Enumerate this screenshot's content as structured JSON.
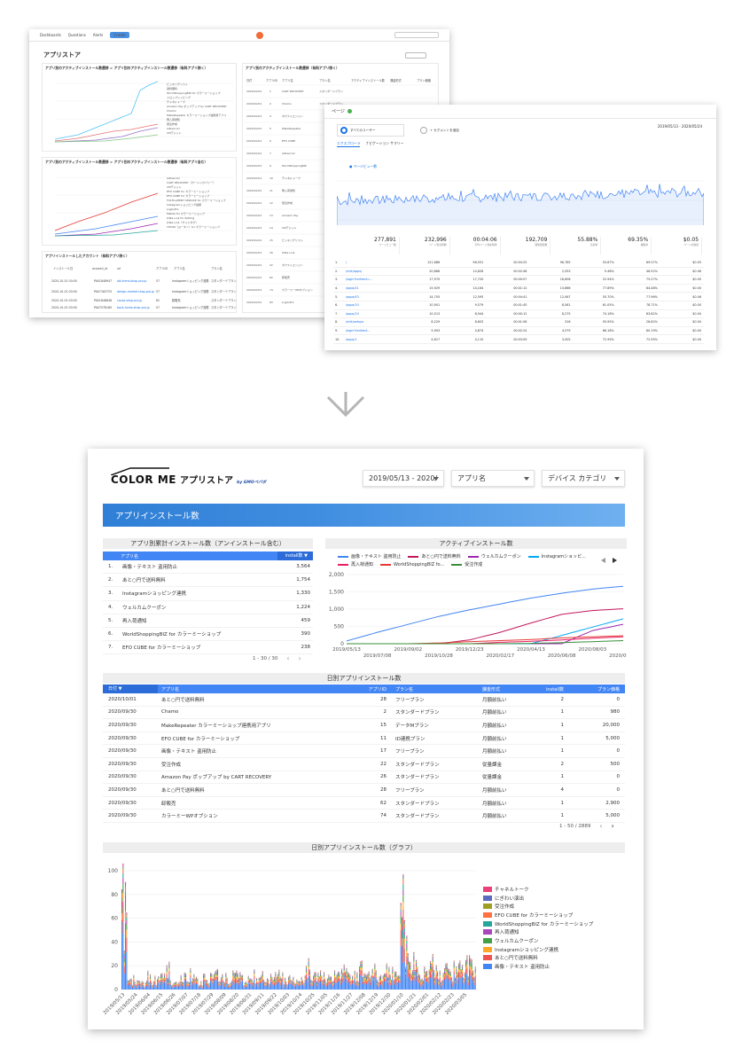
{
  "metabase": {
    "nav": [
      "Dashboards",
      "Questions",
      "Alerts",
      "Create"
    ],
    "title": "アプリストア",
    "panels": [
      {
        "title": "アプリ別のアクティブインストール数遷移 > アプリ別のアクティブインストール数遷移（有料アプリ除く）"
      },
      {
        "title": "アプリ別のアクティブインストール数遷移（有料アプリ除く）"
      },
      {
        "title": "アプリ別のアクティブインストール数遷移 > アプリ別のアクティブインストール数遷移（有料アプリ含む）"
      },
      {
        "title": "アプリインストールしたアカウント（有料アプリ除く）"
      }
    ],
    "table_headers": [
      "日付",
      "アプリID",
      "アプリ名",
      "プラン名",
      "アクティブインストール数",
      "課金形式",
      "プラン価格"
    ]
  },
  "ga": {
    "title": "ページ",
    "segment_all": "すべてのユーザー",
    "segment_add": "+ セグメントを追加",
    "date_range": "2019/05/13 - 2020/05/24",
    "tabs": [
      "エクスプローラ",
      "ナビゲーション サマリー"
    ],
    "metric_label": "● ページビュー数",
    "summary": [
      {
        "num": "277,891",
        "label": "ページビュー数"
      },
      {
        "num": "232,996",
        "label": "ページ別訪問数"
      },
      {
        "num": "00:04:06",
        "label": "平均ページ滞在時間"
      },
      {
        "num": "192,709",
        "label": "閲覧開始数"
      },
      {
        "num": "55.88%",
        "label": "直帰率"
      },
      {
        "num": "69.35%",
        "label": "離脱率"
      },
      {
        "num": "$0.05",
        "label": "ページの価値"
      }
    ],
    "rows": [
      {
        "i": "1.",
        "page": "/",
        "pv": "121,686",
        "u": "96,931",
        "t": "00:04:25",
        "e": "96,785",
        "b": "53.67%",
        "x": "69.57%",
        "v": "$0.05"
      },
      {
        "i": "2.",
        "page": "/mkt/apps/",
        "pv": "20,866",
        "u": "14,826",
        "t": "00:02:48",
        "e": "2,933",
        "b": "9.48%",
        "x": "46.52%",
        "v": "$0.06"
      },
      {
        "i": "3.",
        "page": "/login?redirect=...",
        "pv": "17,970",
        "u": "17,720",
        "t": "00:00:07",
        "e": "16,606",
        "b": "22.94%",
        "x": "75.27%",
        "v": "$0.00"
      },
      {
        "i": "4.",
        "page": "/apps/21",
        "pv": "15,929",
        "u": "14,164",
        "t": "00:01:12",
        "e": "13,666",
        "b": "77.89%",
        "x": "84.48%",
        "v": "$0.00"
      },
      {
        "i": "5.",
        "page": "/apps/43",
        "pv": "14,705",
        "u": "12,595",
        "t": "00:04:41",
        "e": "12,067",
        "b": "55.70%",
        "x": "77.96%",
        "v": "$0.06"
      },
      {
        "i": "6.",
        "page": "/apps/10",
        "pv": "10,901",
        "u": "9,579",
        "t": "00:01:45",
        "e": "8,561",
        "b": "61.05%",
        "x": "78.71%",
        "v": "$0.00"
      },
      {
        "i": "7.",
        "page": "/apps/10",
        "pv": "10,513",
        "u": "8,944",
        "t": "00:00:12",
        "e": "8,275",
        "b": "74.18%",
        "x": "83.82%",
        "v": "$0.00"
      },
      {
        "i": "8.",
        "page": "/mkt/setups",
        "pv": "8,229",
        "u": "8,603",
        "t": "00:01:56",
        "e": "316",
        "b": "93.95%",
        "x": "26.62%",
        "v": "$0.00"
      },
      {
        "i": "9.",
        "page": "/login?redirect...",
        "pv": "5,903",
        "u": "4,874",
        "t": "00:02:24",
        "e": "4,579",
        "b": "66.18%",
        "x": "60.19%",
        "v": "$0.00"
      },
      {
        "i": "10.",
        "page": "/apps/1",
        "pv": "4,617",
        "u": "4,110",
        "t": "00:03:09",
        "e": "3,505",
        "b": "72.99%",
        "x": "72.95%",
        "v": "$0.00"
      }
    ]
  },
  "report": {
    "brand": "COLOR ME",
    "brand_sub": "アプリストア",
    "brand_by": "by GMOペパボ",
    "filters": {
      "date": "2019/05/13 - 2020/",
      "app": "アプリ名",
      "category": "デバイス カテゴリ"
    },
    "banner": "アプリインストール数",
    "cumulative": {
      "title": "アプリ別累計インストール数（アンインストール含む）",
      "col_name": "アプリ名",
      "col_value": "install数 ▼",
      "rows": [
        {
          "i": "1.",
          "name": "画像・テキスト 盗用防止",
          "value": "3,564"
        },
        {
          "i": "2.",
          "name": "あと○円で送料無料",
          "value": "1,754"
        },
        {
          "i": "3.",
          "name": "Instagramショッピング連携",
          "value": "1,330"
        },
        {
          "i": "4.",
          "name": "ウェルカムクーポン",
          "value": "1,224"
        },
        {
          "i": "5.",
          "name": "再入荷通知",
          "value": "459"
        },
        {
          "i": "6.",
          "name": "WorldShoppingBIZ for カラーミーショップ",
          "value": "390"
        },
        {
          "i": "7.",
          "name": "EFO CUBE for カラーミーショップ",
          "value": "238"
        }
      ],
      "pager": "1 - 30 / 30"
    },
    "active": {
      "title": "アクティブインストール数"
    },
    "daily": {
      "title": "日別アプリインストール数",
      "headers": [
        "日付 ▼",
        "アプリ名",
        "アプリID",
        "プラン名",
        "課金形式",
        "install数",
        "プラン価格"
      ],
      "rows": [
        [
          "2020/10/01",
          "あと○円で送料無料",
          "28",
          "フリープラン",
          "月額前払い",
          "2",
          "0"
        ],
        [
          "2020/09/30",
          "Chamo",
          "2",
          "スタンダードプラン",
          "月額前払い",
          "1",
          "980"
        ],
        [
          "2020/09/30",
          "MakeRepeater カラーミーショップ連携用アプリ",
          "15",
          "データMプラン",
          "月額前払い",
          "1",
          "20,000"
        ],
        [
          "2020/09/30",
          "EFO CUBE for カラーミーショップ",
          "11",
          "ID連携プラン",
          "月額前払い",
          "1",
          "5,000"
        ],
        [
          "2020/09/30",
          "画像・テキスト 盗用防止",
          "17",
          "フリープラン",
          "月額前払い",
          "1",
          "0"
        ],
        [
          "2020/09/30",
          "受注作成",
          "22",
          "スタンダードプラン",
          "従量課金",
          "2",
          "500"
        ],
        [
          "2020/09/30",
          "Amazon Pay ポップアップ by CART RECOVERY",
          "26",
          "スタンダードプラン",
          "従量課金",
          "1",
          "0"
        ],
        [
          "2020/09/30",
          "あと○円で送料無料",
          "28",
          "フリープラン",
          "月額前払い",
          "4",
          "0"
        ],
        [
          "2020/09/30",
          "卸販売",
          "62",
          "スタンダードプラン",
          "月額前払い",
          "1",
          "2,900"
        ],
        [
          "2020/09/30",
          "カラーミーWPオプション",
          "74",
          "スタンダードプラン",
          "月額前払い",
          "1",
          "5,000"
        ]
      ],
      "pager": "1 - 50 / 2889"
    },
    "daily_chart": {
      "title": "日別アプリインストール数（グラフ）"
    }
  },
  "chart_data": [
    {
      "type": "line",
      "title": "アクティブインストール数",
      "x": [
        "2019/05/13",
        "2019/07/08",
        "2019/09/02",
        "2019/10/28",
        "2019/12/23",
        "2020/02/17",
        "2020/04/13",
        "2020/06/08",
        "2020/08/03",
        "2020/09/30"
      ],
      "x_tick_labels_top": [
        "2019/05/13",
        "2019/09/02",
        "2019/12/23",
        "2020/04/13",
        "2020/08/03"
      ],
      "x_tick_labels_bottom": [
        "2019/07/08",
        "2019/10/28",
        "2020/02/17",
        "2020/06/08",
        "2020/09/30"
      ],
      "ylim": [
        0,
        2000
      ],
      "yticks": [
        "0",
        "500",
        "1,000",
        "1,500",
        "2,000"
      ],
      "series": [
        {
          "name": "画像・テキスト 盗用防止",
          "color": "#4285f4",
          "values": [
            80,
            330,
            560,
            790,
            980,
            1150,
            1320,
            1460,
            1580,
            1660
          ]
        },
        {
          "name": "あと○円で送料無料",
          "color": "#c2185b",
          "values": [
            0,
            0,
            0,
            0,
            110,
            330,
            600,
            850,
            960,
            1010
          ]
        },
        {
          "name": "ウェルカムクーポン",
          "color": "#9c27b0",
          "values": [
            0,
            0,
            0,
            0,
            0,
            0,
            0,
            0,
            380,
            560
          ]
        },
        {
          "name": "Instagramショッピ...",
          "color": "#03a9f4",
          "values": [
            0,
            0,
            0,
            0,
            0,
            0,
            0,
            240,
            480,
            720
          ]
        },
        {
          "name": "再入荷通知",
          "color": "#e91e63",
          "values": [
            0,
            0,
            0,
            0,
            0,
            40,
            70,
            110,
            160,
            200
          ]
        },
        {
          "name": "WorldShoppingBIZ fo...",
          "color": "#e53935",
          "values": [
            0,
            0,
            0,
            20,
            60,
            90,
            120,
            170,
            200,
            230
          ]
        },
        {
          "name": "受注作成",
          "color": "#388e3c",
          "values": [
            0,
            0,
            0,
            0,
            0,
            0,
            10,
            30,
            60,
            90
          ]
        }
      ]
    },
    {
      "type": "bar",
      "title": "日別アプリインストール数（グラフ）",
      "ylim": [
        0,
        100
      ],
      "yticks": [
        "0",
        "20",
        "40",
        "60",
        "80",
        "100"
      ],
      "x_tick_labels": [
        "2019/05/13",
        "2019/05/24",
        "2019/06/04",
        "2019/06/15",
        "2019/06/26",
        "2019/07/07",
        "2019/07/18",
        "2019/07/29",
        "2019/08/09",
        "2019/08/20",
        "2019/08/31",
        "2019/09/11",
        "2019/09/22",
        "2019/10/03",
        "2019/10/14",
        "2019/10/25",
        "2019/11/05",
        "2019/11/16",
        "2019/11/27",
        "2019/12/08",
        "2019/12/19",
        "2019/12/30",
        "2020/01/10",
        "2020/01/21",
        "2020/02/01",
        "2020/02/12",
        "2020/02/23",
        "2020/03/05"
      ],
      "series": [
        {
          "name": "チャネルトーク",
          "color": "#ec407a"
        },
        {
          "name": "にぎわい演出",
          "color": "#5c6bc0"
        },
        {
          "name": "受注作成",
          "color": "#9e9d24"
        },
        {
          "name": "EFO CUBE for カラーミーショップ",
          "color": "#ff7043"
        },
        {
          "name": "WorldShoppingBIZ for カラーミーショップ",
          "color": "#26a69a"
        },
        {
          "name": "再入荷通知",
          "color": "#ab47bc"
        },
        {
          "name": "ウェルカムクーポン",
          "color": "#43a047"
        },
        {
          "name": "Instagramショッピング連携",
          "color": "#ffa726"
        },
        {
          "name": "あと○円で送料無料",
          "color": "#ef5350"
        },
        {
          "name": "画像・テキスト 盗用防止",
          "color": "#4285f4"
        }
      ],
      "approx_daily_totals": [
        80,
        10,
        8,
        12,
        6,
        14,
        10,
        8,
        12,
        18,
        8,
        6,
        10,
        12,
        14,
        10,
        8,
        12,
        10,
        16,
        10,
        12,
        8,
        14,
        12,
        10,
        8,
        12,
        10,
        14,
        10,
        12,
        16,
        12,
        12,
        14,
        10,
        12,
        22,
        14,
        12,
        16,
        14,
        12,
        14,
        16,
        18,
        14,
        12,
        16,
        20,
        14,
        16,
        14,
        12,
        18,
        14,
        16,
        80,
        40,
        30,
        20,
        18,
        16,
        22,
        18,
        16,
        20,
        22,
        18,
        24,
        20,
        26,
        22
      ]
    }
  ]
}
